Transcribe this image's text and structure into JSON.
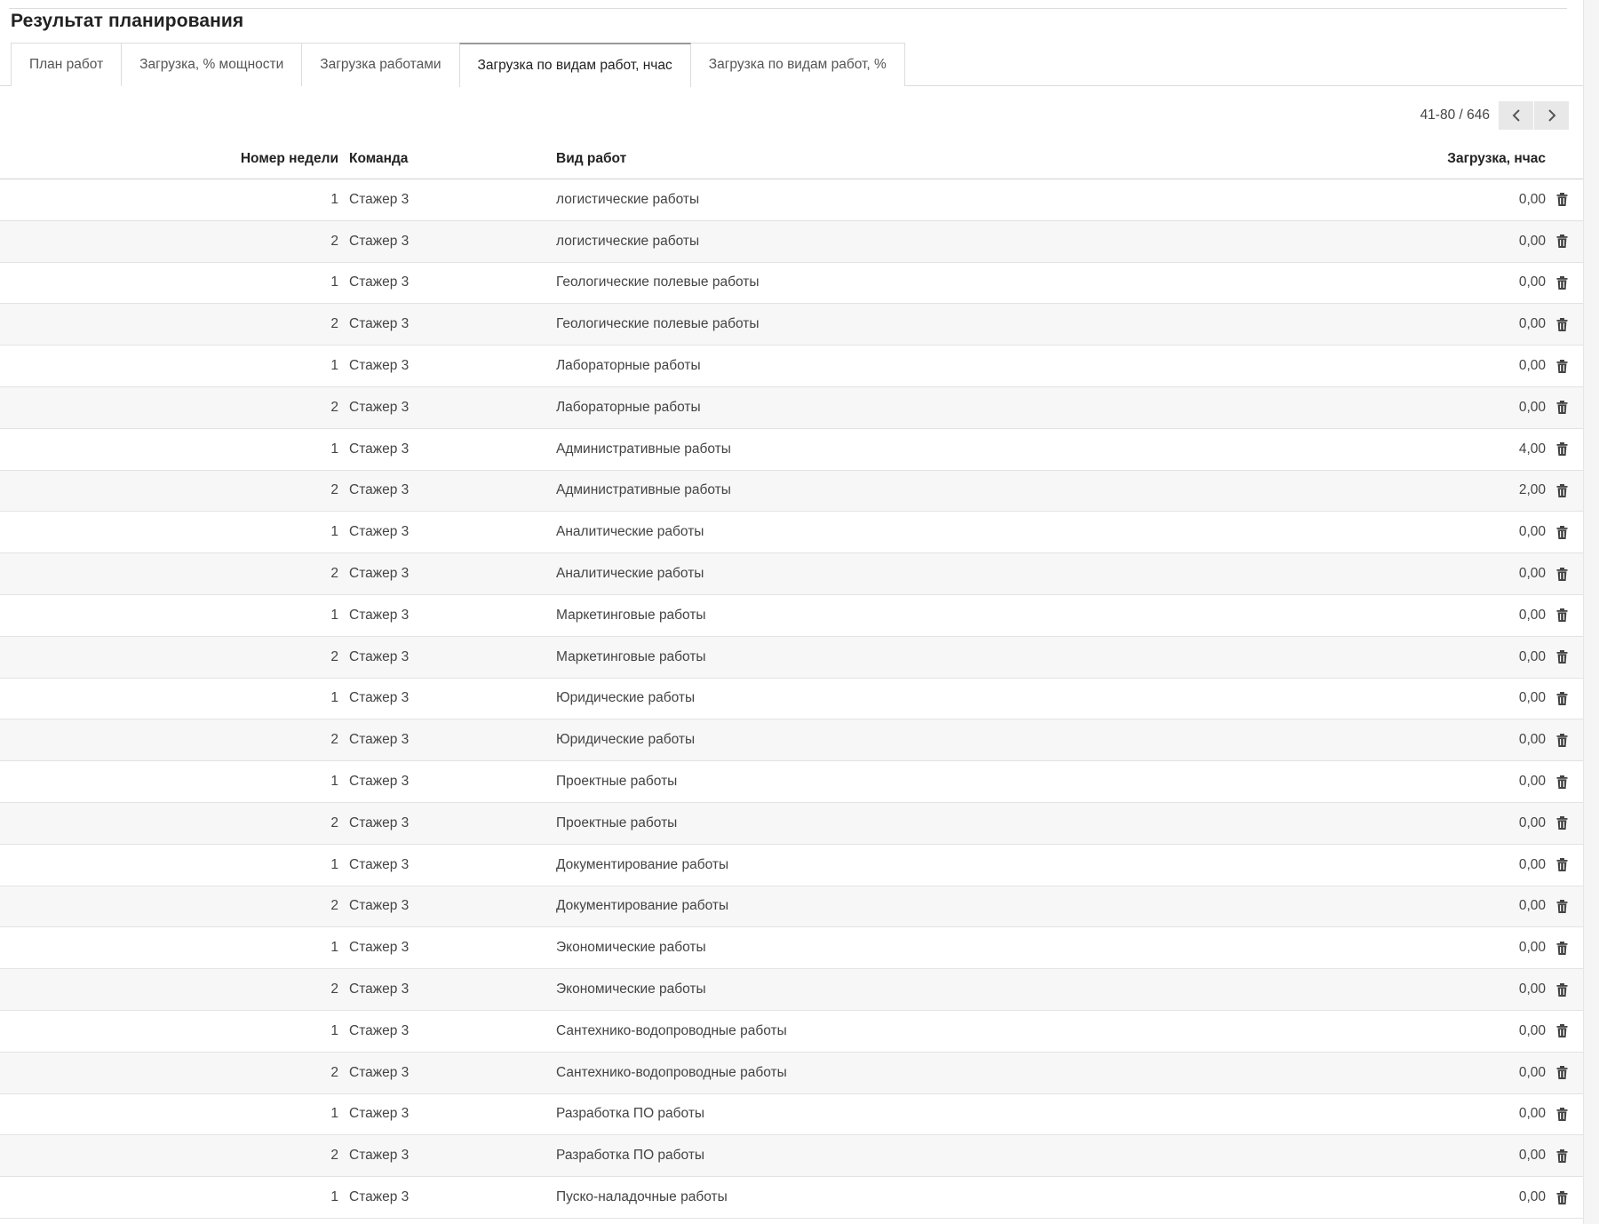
{
  "page": {
    "title": "Результат планирования"
  },
  "tabs": [
    {
      "label": "План работ",
      "active": false
    },
    {
      "label": "Загрузка, % мощности",
      "active": false
    },
    {
      "label": "Загрузка работами",
      "active": false
    },
    {
      "label": "Загрузка по видам работ, нчас",
      "active": true
    },
    {
      "label": "Загрузка по видам работ, %",
      "active": false
    }
  ],
  "pager": {
    "value": "41-80 / 646",
    "prev_icon": "chevron-left-icon",
    "next_icon": "chevron-right-icon"
  },
  "table": {
    "columns": {
      "week": "Номер недели",
      "team": "Команда",
      "kind": "Вид работ",
      "load": "Загрузка, нчас"
    },
    "row_action_icon": "trash-icon",
    "rows": [
      {
        "week": "1",
        "team": "Стажер 3",
        "kind": "логистические работы",
        "load": "0,00"
      },
      {
        "week": "2",
        "team": "Стажер 3",
        "kind": "логистические работы",
        "load": "0,00"
      },
      {
        "week": "1",
        "team": "Стажер 3",
        "kind": "Геологические полевые работы",
        "load": "0,00"
      },
      {
        "week": "2",
        "team": "Стажер 3",
        "kind": "Геологические полевые работы",
        "load": "0,00"
      },
      {
        "week": "1",
        "team": "Стажер 3",
        "kind": "Лабораторные работы",
        "load": "0,00"
      },
      {
        "week": "2",
        "team": "Стажер 3",
        "kind": "Лабораторные работы",
        "load": "0,00"
      },
      {
        "week": "1",
        "team": "Стажер 3",
        "kind": "Административные работы",
        "load": "4,00"
      },
      {
        "week": "2",
        "team": "Стажер 3",
        "kind": "Административные работы",
        "load": "2,00"
      },
      {
        "week": "1",
        "team": "Стажер 3",
        "kind": "Аналитические работы",
        "load": "0,00"
      },
      {
        "week": "2",
        "team": "Стажер 3",
        "kind": "Аналитические работы",
        "load": "0,00"
      },
      {
        "week": "1",
        "team": "Стажер 3",
        "kind": "Маркетинговые работы",
        "load": "0,00"
      },
      {
        "week": "2",
        "team": "Стажер 3",
        "kind": "Маркетинговые работы",
        "load": "0,00"
      },
      {
        "week": "1",
        "team": "Стажер 3",
        "kind": "Юридические работы",
        "load": "0,00"
      },
      {
        "week": "2",
        "team": "Стажер 3",
        "kind": "Юридические работы",
        "load": "0,00"
      },
      {
        "week": "1",
        "team": "Стажер 3",
        "kind": "Проектные работы",
        "load": "0,00"
      },
      {
        "week": "2",
        "team": "Стажер 3",
        "kind": "Проектные работы",
        "load": "0,00"
      },
      {
        "week": "1",
        "team": "Стажер 3",
        "kind": "Документирование работы",
        "load": "0,00"
      },
      {
        "week": "2",
        "team": "Стажер 3",
        "kind": "Документирование работы",
        "load": "0,00"
      },
      {
        "week": "1",
        "team": "Стажер 3",
        "kind": "Экономические работы",
        "load": "0,00"
      },
      {
        "week": "2",
        "team": "Стажер 3",
        "kind": "Экономические работы",
        "load": "0,00"
      },
      {
        "week": "1",
        "team": "Стажер 3",
        "kind": "Сантехнико-водопроводные работы",
        "load": "0,00"
      },
      {
        "week": "2",
        "team": "Стажер 3",
        "kind": "Сантехнико-водопроводные работы",
        "load": "0,00"
      },
      {
        "week": "1",
        "team": "Стажер 3",
        "kind": "Разработка ПО работы",
        "load": "0,00"
      },
      {
        "week": "2",
        "team": "Стажер 3",
        "kind": "Разработка ПО работы",
        "load": "0,00"
      },
      {
        "week": "1",
        "team": "Стажер 3",
        "kind": "Пуско-наладочные работы",
        "load": "0,00"
      }
    ]
  }
}
